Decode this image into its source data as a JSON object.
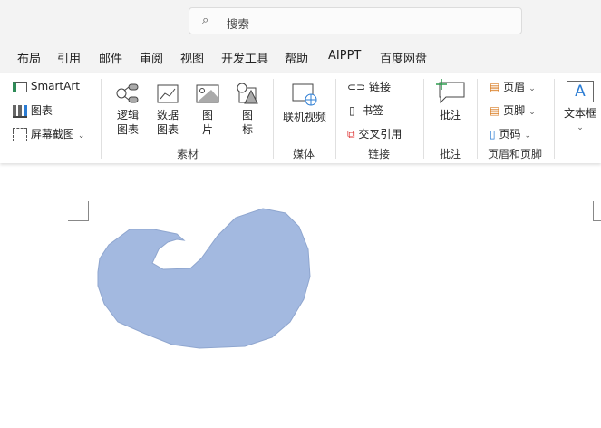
{
  "search": {
    "placeholder": "搜索"
  },
  "menu": [
    "布局",
    "引用",
    "邮件",
    "审阅",
    "视图",
    "开发工具",
    "帮助",
    "AIPPT",
    "百度网盘"
  ],
  "ribbon": {
    "smartart": "SmartArt",
    "chart": "图表",
    "screenshot": "屏幕截图",
    "logic_chart": [
      "逻辑",
      "图表"
    ],
    "data_chart": [
      "数据",
      "图表"
    ],
    "picture": [
      "图",
      "片"
    ],
    "icon": [
      "图",
      "标"
    ],
    "group_material": "素材",
    "online_video": "联机视频",
    "group_media": "媒体",
    "link": "链接",
    "bookmark": "书签",
    "cross_ref": "交叉引用",
    "group_links": "链接",
    "comment": "批注",
    "group_comment": "批注",
    "header": "页眉",
    "footer": "页脚",
    "page_number": "页码",
    "group_header_footer": "页眉和页脚",
    "textbox": "文本框"
  },
  "colors": {
    "shape_fill": "#a3b9e0",
    "accent": "#2b7cd3"
  }
}
